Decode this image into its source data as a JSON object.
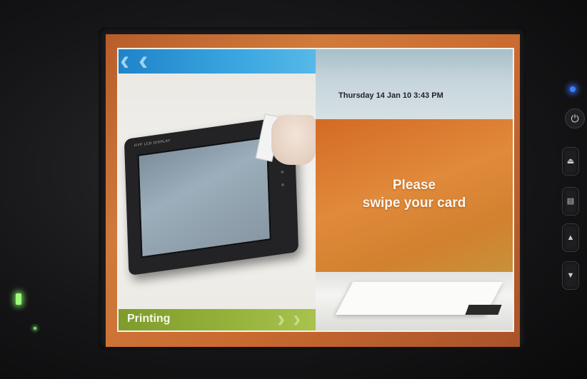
{
  "screen": {
    "datetime": "Thursday 14 Jan 10  3:43 PM",
    "message_line1": "Please",
    "message_line2": "swipe your card",
    "section_label": "Printing",
    "terminal_brand": "HYP LCD DISPLAY"
  },
  "hardware": {
    "power_icon": "power-icon",
    "buttons": [
      "eject-icon",
      "page-icon",
      "up-arrow-icon",
      "down-arrow-icon"
    ],
    "led_color_power": "#3f7cff",
    "led_color_status": "#9cff7a"
  },
  "colors": {
    "accent_orange": "#d46a25",
    "accent_blue": "#1f83c8",
    "accent_green": "#94b23a"
  }
}
